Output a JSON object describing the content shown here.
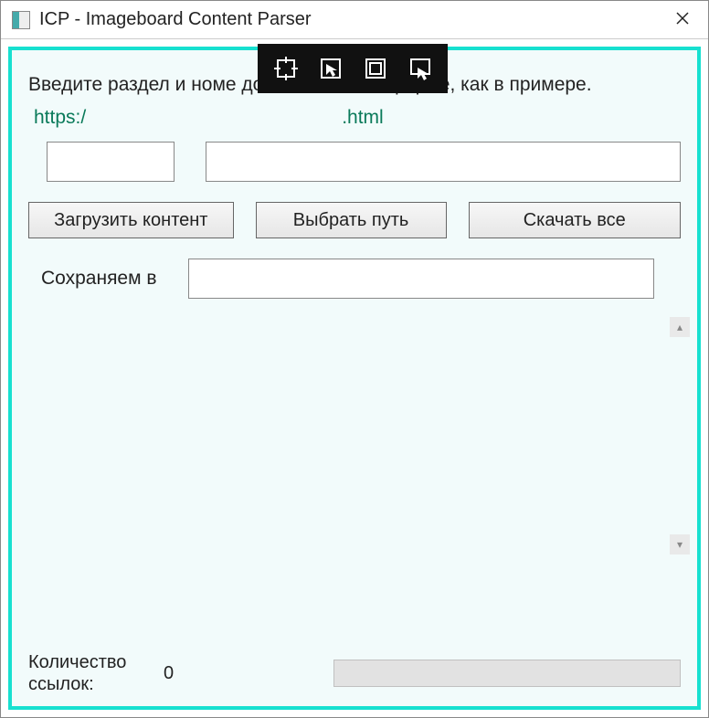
{
  "window": {
    "title": "ICP - Imageboard Content Parser"
  },
  "main": {
    "instruction": "Введите раздел и номе                                    должно быть по форме, как в примере.",
    "url_prefix": "https:/",
    "url_suffix": ".html",
    "buttons": {
      "load": "Загрузить контент",
      "choose_path": "Выбрать путь",
      "download_all": "Скачать все"
    },
    "save_label": "Сохраняем в",
    "links_label": "Количество ссылок:",
    "links_count": "0"
  },
  "inputs": {
    "section_value": "",
    "thread_value": "",
    "save_path_value": ""
  }
}
